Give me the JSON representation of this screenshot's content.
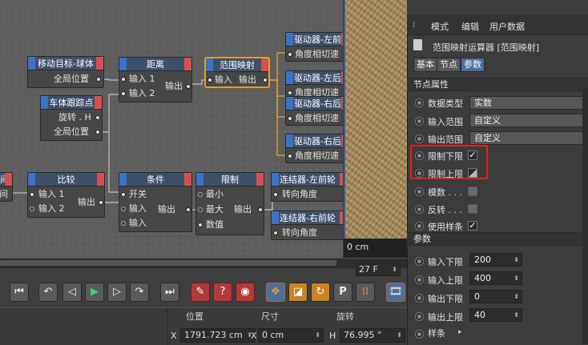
{
  "nodes": {
    "n1": {
      "title": "移动目标-球体",
      "ports": [
        "全局位置"
      ]
    },
    "n2": {
      "title": "车体跟踪点",
      "ports": [
        "旋转 . H",
        "全局位置"
      ]
    },
    "n3": {
      "title": "距离",
      "ports": [
        "输入 1",
        "输入 2",
        "输出"
      ]
    },
    "n4": {
      "title": "范围映射",
      "ports": [
        "输入",
        "输出"
      ]
    },
    "n5": {
      "title": "驱动器-左前",
      "ports": [
        "角度相切速"
      ]
    },
    "n6": {
      "title": "驱动器-左后",
      "ports": [
        "角度相切速"
      ]
    },
    "n7": {
      "title": "驱动器-右后",
      "ports": [
        "角度相切速"
      ]
    },
    "n8": {
      "title": "驱动器-右后",
      "ports": [
        "角度相切速"
      ]
    },
    "n9": {
      "title": "比较",
      "ports": [
        "输入 1",
        "输入 2",
        "输出"
      ]
    },
    "n10": {
      "title": "条件",
      "ports": [
        "开关",
        "输入",
        "输入",
        "输出"
      ]
    },
    "n11": {
      "title": "限制",
      "ports": [
        "最小",
        "最大",
        "数值",
        "输出"
      ]
    },
    "n12": {
      "title": "连结器-左前轮",
      "ports": [
        "转向角度"
      ]
    },
    "n13": {
      "title": "连结器-右前轮",
      "ports": [
        "转向角度"
      ]
    },
    "n14": {
      "title": "间",
      "ports": [
        "间"
      ]
    }
  },
  "viewport": {
    "unit_label": "0 cm"
  },
  "timeline": {
    "frame_value": "27 F",
    "buttons": [
      "go-start",
      "prev-key",
      "prev-frame",
      "play",
      "next-frame",
      "next-key",
      "go-end",
      "record",
      "auto-key",
      "keyframe-selection",
      "p",
      "dots",
      "move",
      "scale",
      "rotate",
      "film"
    ]
  },
  "coords": {
    "headers": [
      "位置",
      "尺寸",
      "旋转"
    ],
    "axis_x": "X",
    "pos_x": "1791.723 cm",
    "axis_x2": "X",
    "size_x": "0 cm",
    "axis_h": "H",
    "rot_h": "76.995 °"
  },
  "attr": {
    "menu": [
      "模式",
      "编辑",
      "用户数据"
    ],
    "title": "范围映射运算器 [范围映射]",
    "tabs": [
      "基本",
      "节点",
      "参数"
    ],
    "section_node": "节点属性",
    "data_type_label": "数据类型",
    "data_type_value": "实数",
    "input_range_label": "输入范围",
    "input_range_value": "自定义",
    "output_range_label": "输出范围",
    "output_range_value": "自定义",
    "clamp_lower_label": "限制下限",
    "clamp_upper_label": "限制上限",
    "modulo_label": "模数 . . .",
    "reverse_label": "反转 . . .",
    "use_spline_label": "使用样条",
    "check_mark": "✓",
    "section_params": "参数",
    "input_lower_label": "输入下限",
    "input_lower_value": "200",
    "input_upper_label": "输入上限",
    "input_upper_value": "400",
    "output_lower_label": "输出下限",
    "output_lower_value": "0",
    "output_upper_label": "输出上限",
    "output_upper_value": "40",
    "spline_label": "样条",
    "spinner": "⬍"
  }
}
